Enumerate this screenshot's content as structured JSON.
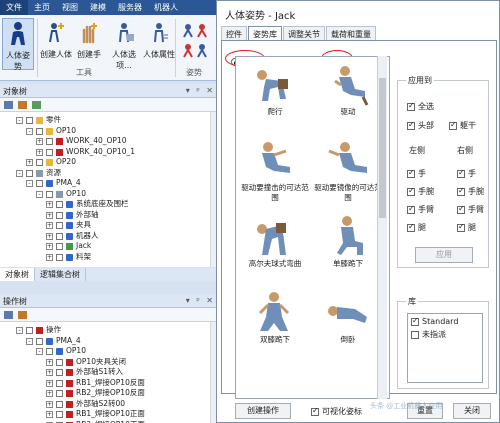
{
  "ribbon": {
    "tabs": [
      "文件",
      "主页",
      "视图",
      "建模",
      "服务器",
      "机器人"
    ],
    "buttons": [
      {
        "label": "人体姿势",
        "icon": "human-posture-icon",
        "active": true
      },
      {
        "label": "创建人体",
        "icon": "create-human-icon"
      },
      {
        "label": "创建手",
        "icon": "create-hand-icon"
      },
      {
        "label": "人体选项...",
        "icon": "human-options-icon"
      },
      {
        "label": "人体属性",
        "icon": "human-properties-icon"
      }
    ],
    "group_tools": "工具",
    "group_pose": "姿势"
  },
  "object_tree": {
    "title": "对象树",
    "controls": "▾ ᵖ ✕",
    "rows": [
      {
        "label": "零件",
        "level": 1,
        "exp": "-",
        "icon": "yel"
      },
      {
        "label": "OP10",
        "level": 2,
        "exp": "-",
        "icon": "yel"
      },
      {
        "label": "WORK_40_OP10",
        "level": 3,
        "exp": "+",
        "icon": "red"
      },
      {
        "label": "WORK_40_OP10_1",
        "level": 3,
        "exp": "+",
        "icon": "red"
      },
      {
        "label": "OP20",
        "level": 2,
        "exp": "+",
        "icon": "yel"
      },
      {
        "label": "资源",
        "level": 1,
        "exp": "-",
        "icon": "gry"
      },
      {
        "label": "PMA_4",
        "level": 2,
        "exp": "-",
        "icon": "blue"
      },
      {
        "label": "OP10",
        "level": 3,
        "exp": "-",
        "icon": "gry"
      },
      {
        "label": "系统底座及围栏",
        "level": 4,
        "exp": "+",
        "icon": "blue"
      },
      {
        "label": "外部轴",
        "level": 4,
        "exp": "+",
        "icon": "blue"
      },
      {
        "label": "夹具",
        "level": 4,
        "exp": "+",
        "icon": "blue"
      },
      {
        "label": "机器人",
        "level": 4,
        "exp": "+",
        "icon": "blue"
      },
      {
        "label": "Jack",
        "level": 4,
        "exp": "+",
        "icon": "grn"
      },
      {
        "label": "料架",
        "level": 4,
        "exp": "+",
        "icon": "blue"
      }
    ],
    "tabs": [
      "对象树",
      "逻辑集合树"
    ]
  },
  "operation_tree": {
    "title": "操作树",
    "controls": "▾ ᵖ ✕",
    "rows": [
      {
        "label": "操作",
        "level": 1,
        "exp": "-",
        "icon": "red"
      },
      {
        "label": "PMA_4",
        "level": 2,
        "exp": "-",
        "icon": "blue"
      },
      {
        "label": "OP10",
        "level": 3,
        "exp": "-",
        "icon": "blue"
      },
      {
        "label": "OP10夹具关闭",
        "level": 4,
        "exp": "+",
        "icon": "red"
      },
      {
        "label": "外部轴S1转入",
        "level": 4,
        "exp": "+",
        "icon": "red"
      },
      {
        "label": "RB1_焊接OP10反面",
        "level": 4,
        "exp": "+",
        "icon": "red"
      },
      {
        "label": "RB2_焊接OP10反面",
        "level": 4,
        "exp": "+",
        "icon": "red"
      },
      {
        "label": "外部轴S2转00",
        "level": 4,
        "exp": "+",
        "icon": "red"
      },
      {
        "label": "RB1_焊接OP10正面",
        "level": 4,
        "exp": "+",
        "icon": "red"
      },
      {
        "label": "RB2_焊接OP10正面",
        "level": 4,
        "exp": "+",
        "icon": "red"
      }
    ]
  },
  "dialog": {
    "title": "人体姿势 - Jack",
    "tabs": [
      "控件",
      "姿势库",
      "调整关节",
      "载荷和重量"
    ],
    "active_tab": 1,
    "radio_full_body": "全身",
    "radio_hand": "手",
    "poses": [
      "爬行",
      "驱动",
      "驱动要撞击的可达范围",
      "驱动要镜像的可达范围",
      "高尔夫球式弯曲",
      "单膝跪下",
      "双膝跪下",
      "倒卧"
    ],
    "apply_to": {
      "title": "应用到",
      "all": "全选",
      "head": "头部",
      "spine": "躯干",
      "left": "左侧",
      "right": "右侧",
      "left_items": [
        "手",
        "手腕",
        "手臂",
        "腿"
      ],
      "right_items": [
        "手",
        "手腕",
        "手臂",
        "腿"
      ],
      "apply_button": "应用"
    },
    "library": {
      "title": "库",
      "items": [
        {
          "label": "Standard",
          "checked": true
        },
        {
          "label": "未指派",
          "checked": false
        }
      ]
    },
    "create_op_button": "创建操作",
    "collision_checkbox": "可视化姿标",
    "reset_button": "重置",
    "close_button": "关闭",
    "watermark": "头条 @工业机器人应用"
  }
}
